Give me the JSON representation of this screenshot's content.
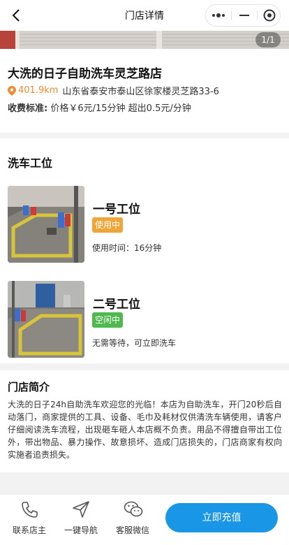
{
  "nav": {
    "title": "门店详情"
  },
  "banner": {
    "counter": "1/1"
  },
  "store": {
    "name": "大洗的日子自助洗车灵芝路店",
    "distance": "401.9km",
    "address": "山东省泰安市泰山区徐家楼灵芝路33-6",
    "fee_label": "收费标准:",
    "fee_text": "价格￥6元/15分钟 超出0.5元/分钟"
  },
  "bays": {
    "title": "洗车工位",
    "items": [
      {
        "name": "一号工位",
        "status": "使用中",
        "status_color": "#f0a53a",
        "info": "使用时间：16分钟"
      },
      {
        "name": "二号工位",
        "status": "空闲中",
        "status_color": "#4fb84f",
        "info": "无需等待，可立即洗车"
      }
    ]
  },
  "intro": {
    "title": "门店简介",
    "text": "大洗的日子24h自助洗车欢迎您的光临！本店为自助洗车，开门20秒后自动落门，商家提供的工具、设备、毛巾及耗材仅供清洗车辆使用，请客户仔细阅读洗车流程，出现砸车砸人本店概不负责。用品不得擅自带出工位外，带出物品、暴力操作、故意损坏、造成门店损失的，门店商家有权向实施者追责损失。"
  },
  "footer": {
    "contact": "联系店主",
    "navigate": "一键导航",
    "service": "客服微信",
    "recharge": "立即充值"
  },
  "colors": {
    "accent": "#1a96e6",
    "distance": "#f08a2c"
  }
}
